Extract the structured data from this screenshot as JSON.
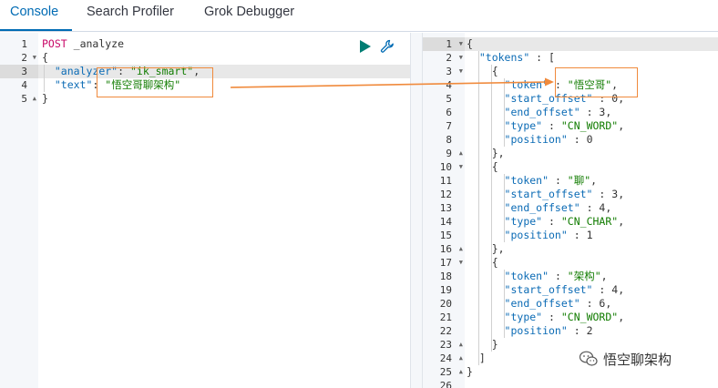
{
  "tabs": [
    {
      "label": "Console",
      "active": true
    },
    {
      "label": "Search Profiler",
      "active": false
    },
    {
      "label": "Grok Debugger",
      "active": false
    }
  ],
  "request": {
    "line_numbers": [
      "1",
      "2",
      "3",
      "4",
      "5"
    ],
    "method": "POST",
    "endpoint": "_analyze",
    "open_brace": "{",
    "analyzer_key": "\"analyzer\"",
    "analyzer_value": "\"ik_smart\"",
    "text_key": "\"text\"",
    "text_value": "\"悟空哥聊架构\"",
    "close_brace": "}"
  },
  "response": {
    "line_numbers": [
      "1",
      "2",
      "3",
      "4",
      "5",
      "6",
      "7",
      "8",
      "9",
      "10",
      "11",
      "12",
      "13",
      "14",
      "15",
      "16",
      "17",
      "18",
      "19",
      "20",
      "21",
      "22",
      "23",
      "24",
      "25",
      "26"
    ],
    "tokens_key": "\"tokens\"",
    "tokens": [
      {
        "token": "\"悟空哥\"",
        "start_offset": "0",
        "end_offset": "3",
        "type": "\"CN_WORD\"",
        "position": "0"
      },
      {
        "token": "\"聊\"",
        "start_offset": "3",
        "end_offset": "4",
        "type": "\"CN_CHAR\"",
        "position": "1"
      },
      {
        "token": "\"架构\"",
        "start_offset": "4",
        "end_offset": "6",
        "type": "\"CN_WORD\"",
        "position": "2"
      }
    ],
    "field_keys": {
      "token": "\"token\"",
      "start_offset": "\"start_offset\"",
      "end_offset": "\"end_offset\"",
      "type": "\"type\"",
      "position": "\"position\""
    }
  },
  "watermark": {
    "text": "悟空聊架构"
  },
  "colors": {
    "accent": "#006bb4",
    "annotation": "#f08a3c",
    "method": "#c80a68",
    "key": "#0b6bb5",
    "string": "#117c00"
  },
  "icons": {
    "run": "play-icon",
    "settings": "wrench-icon",
    "fold": "fold-triangle-icon",
    "watermark_logo": "wechat-logo-icon"
  }
}
